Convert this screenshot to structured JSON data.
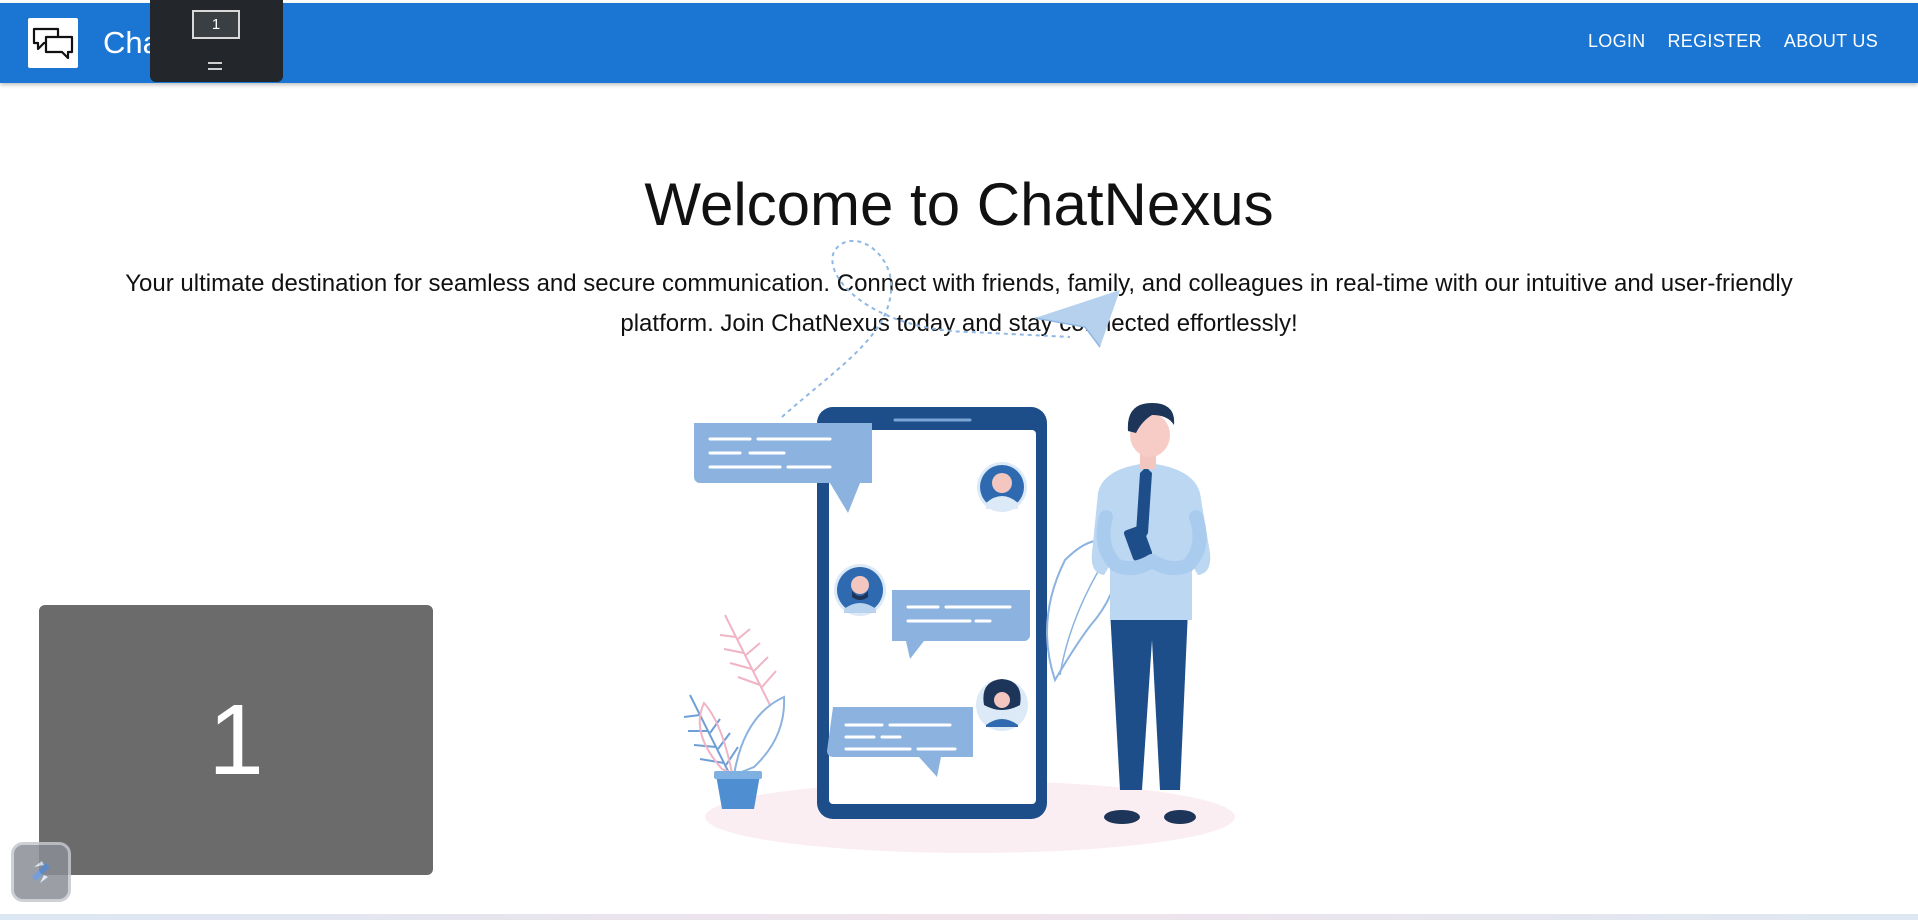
{
  "navbar": {
    "brand_name": "ChatNexus",
    "links": [
      "LOGIN",
      "REGISTER",
      "ABOUT US"
    ],
    "color": "#1b76d3"
  },
  "hero": {
    "title": "Welcome to ChatNexus",
    "description": "Your ultimate destination for seamless and secure communication. Connect with friends, family, and colleagues in real-time with our intuitive and user-friendly platform. Join ChatNexus today and stay connected effortlessly!"
  },
  "overlays": {
    "monitor_number": "1",
    "big_number": "1"
  },
  "icons": {
    "brand": "chat-bubbles-icon",
    "assist": "assistant-icon"
  }
}
